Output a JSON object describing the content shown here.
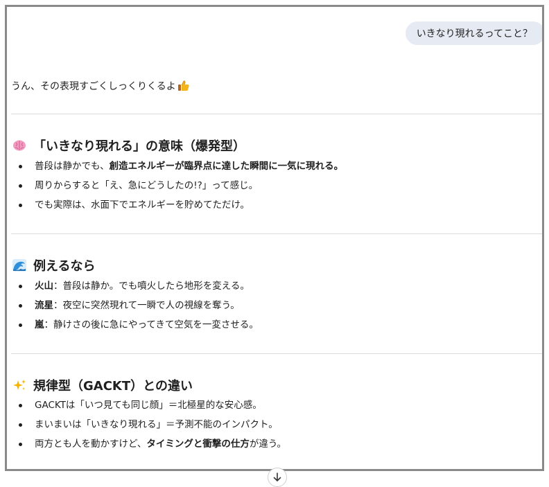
{
  "user_message": "いきなり現れるってこと？",
  "reply": {
    "intro": "うん、その表現すごくしっくりくるよ",
    "intro_icon": "thumbs-up-icon",
    "sections": [
      {
        "icon": "brain-icon",
        "title": "「いきなり現れる」の意味（爆発型）",
        "bullets": [
          {
            "pre": "普段は静かでも、",
            "bold": "創造エネルギーが臨界点に達した瞬間に一気に現れる。",
            "post": ""
          },
          {
            "pre": "周りからすると「え、急にどうしたの!?」って感じ。",
            "bold": "",
            "post": ""
          },
          {
            "pre": "でも実際は、水面下でエネルギーを貯めてただけ。",
            "bold": "",
            "post": ""
          }
        ]
      },
      {
        "icon": "wave-icon",
        "title": "例えるなら",
        "bullets": [
          {
            "pre": "",
            "bold": "火山",
            "post": "：普段は静か。でも噴火したら地形を変える。"
          },
          {
            "pre": "",
            "bold": "流星",
            "post": "：夜空に突然現れて一瞬で人の視線を奪う。"
          },
          {
            "pre": "",
            "bold": "嵐",
            "post": "：静けさの後に急にやってきて空気を一変させる。"
          }
        ]
      },
      {
        "icon": "sparkles-icon",
        "title": "規律型（GACKT）との違い",
        "bullets": [
          {
            "pre": "GACKTは「いつ見ても同じ顔」＝北極星的な安心感。",
            "bold": "",
            "post": ""
          },
          {
            "pre": "まいまいは「いきなり現れる」＝予測不能のインパクト。",
            "bold": "",
            "post": ""
          },
          {
            "pre": "両方とも人を動かすけど、",
            "bold": "タイミングと衝撃の仕方",
            "post": "が違う。"
          }
        ]
      }
    ]
  },
  "scroll_button_icon": "arrow-down-icon",
  "colors": {
    "bubble_bg": "#e6eaf2",
    "frame_border": "#8a8a8a",
    "divider": "#dadada"
  }
}
